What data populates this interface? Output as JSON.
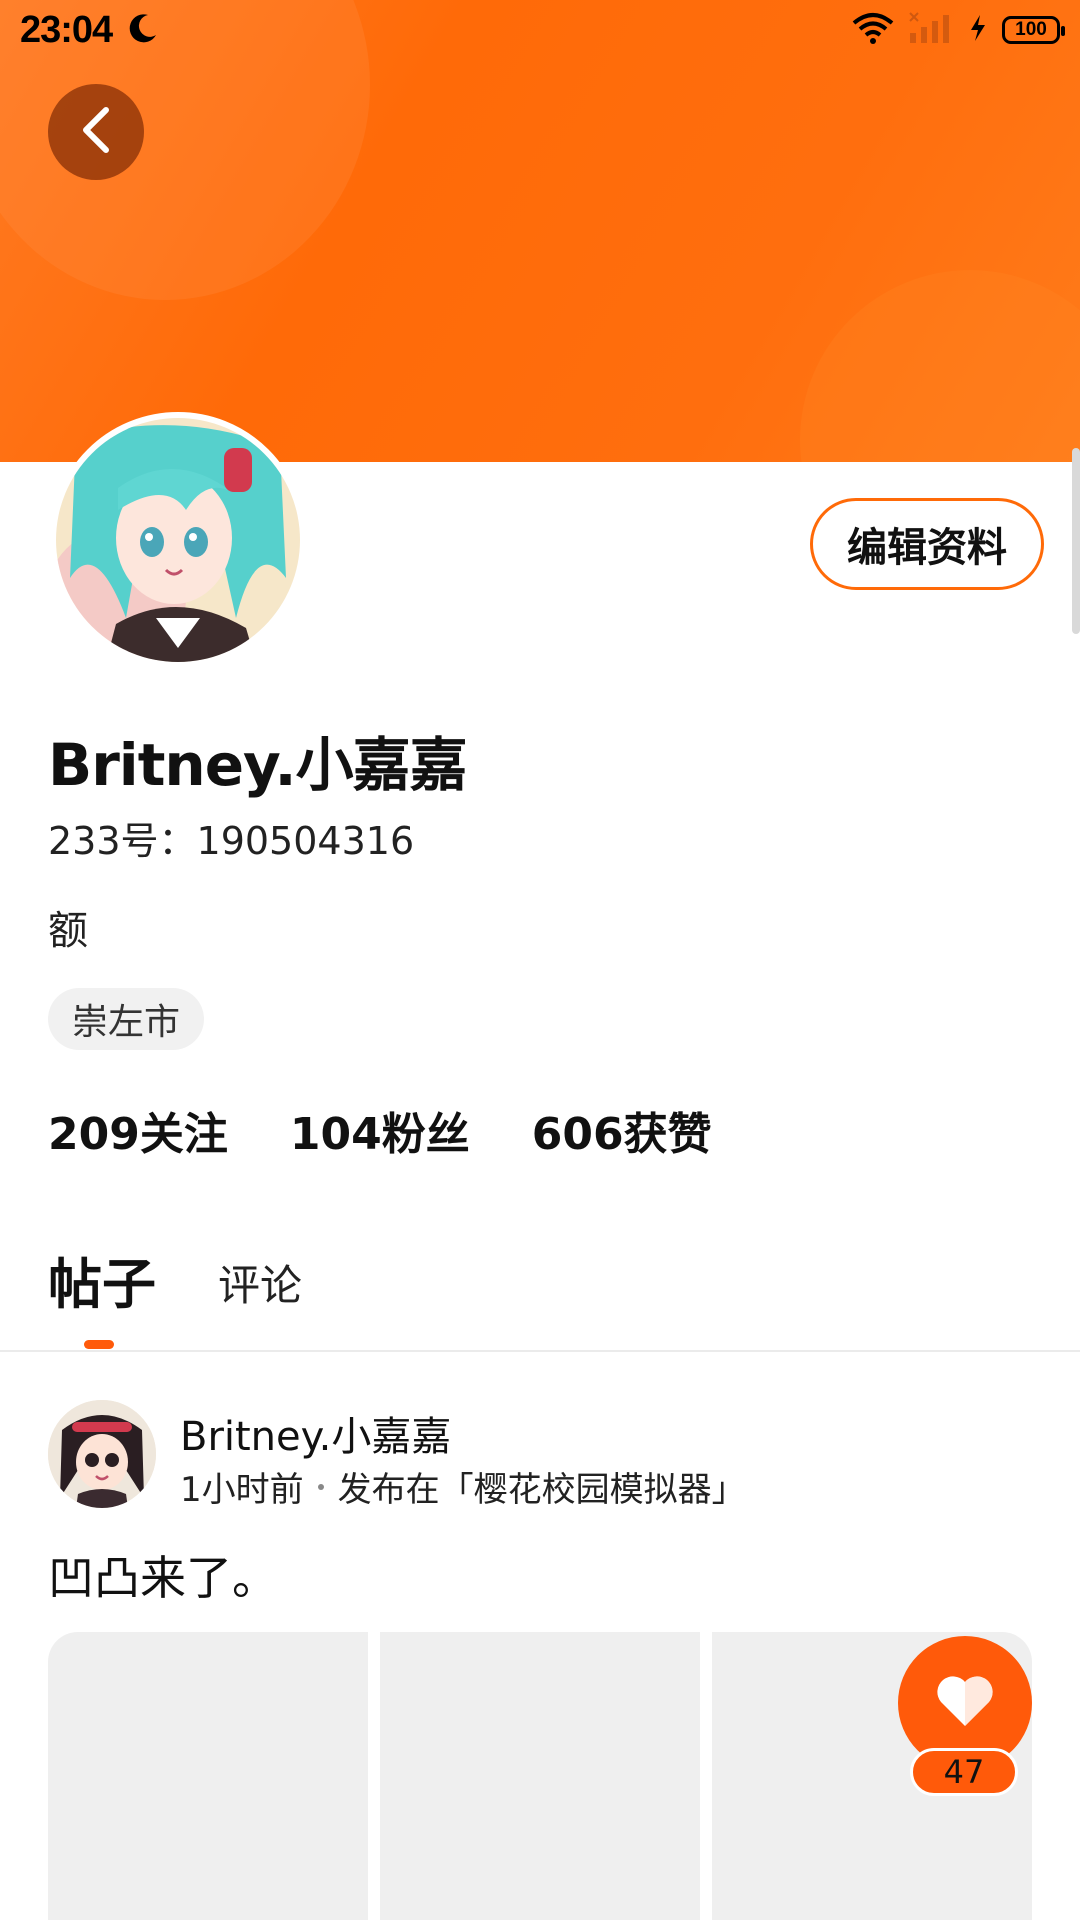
{
  "status_bar": {
    "time": "23:04",
    "battery": "100",
    "icons": [
      "moon-icon",
      "wifi-icon",
      "cellular-signal-icon",
      "charging-icon",
      "battery-icon"
    ]
  },
  "header": {
    "back_icon": "chevron-left-icon",
    "banner_colors": [
      "#ff7a22",
      "#ff6a08"
    ]
  },
  "profile": {
    "edit_label": "编辑资料",
    "username": "Britney.小嘉嘉",
    "id_text": "233号：190504316",
    "bio": "额",
    "location": "崇左市",
    "stats": [
      {
        "count": "209",
        "label": "关注"
      },
      {
        "count": "104",
        "label": "粉丝"
      },
      {
        "count": "606",
        "label": "获赞"
      }
    ]
  },
  "tabs": [
    {
      "label": "帖子",
      "active": true
    },
    {
      "label": "评论",
      "active": false
    }
  ],
  "post": {
    "author": "Britney.小嘉嘉",
    "time": "1小时前",
    "published_in": "发布在「樱花校园模拟器」",
    "text": "凹凸来了。",
    "image_count": 3
  },
  "like": {
    "count": "47",
    "icon": "heart-icon"
  },
  "colors": {
    "accent": "#ff5a0a",
    "tag_background": "#f1f1f1",
    "image_placeholder": "#efefef"
  }
}
